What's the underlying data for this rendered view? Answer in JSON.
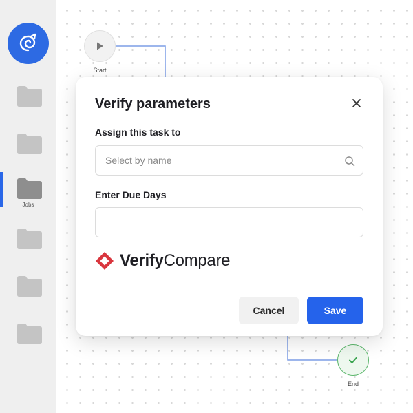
{
  "sidebar": {
    "active_item_label": "Jobs",
    "items": [
      {
        "icon": "folder-icon"
      },
      {
        "icon": "folder-icon"
      },
      {
        "icon": "folder-icon",
        "label": "Jobs"
      },
      {
        "icon": "folder-icon"
      },
      {
        "icon": "folder-icon"
      },
      {
        "icon": "folder-icon"
      }
    ]
  },
  "canvas": {
    "start_label": "Start",
    "end_label": "End"
  },
  "modal": {
    "title": "Verify parameters",
    "assign_label": "Assign this task to",
    "assign_placeholder": "Select by name",
    "assign_value": "",
    "due_days_label": "Enter Due Days",
    "due_days_value": "",
    "brand_verify": "Verify",
    "brand_compare": "Compare",
    "cancel_label": "Cancel",
    "save_label": "Save"
  },
  "colors": {
    "accent": "#2563eb",
    "logo_bg": "#2d6ae3",
    "brand_red": "#d9363e",
    "end_green": "#5fb86f"
  }
}
